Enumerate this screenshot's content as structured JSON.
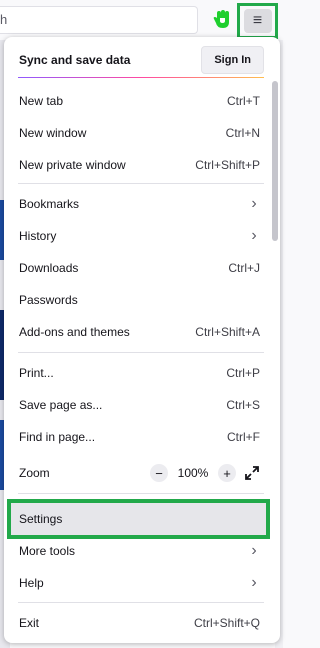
{
  "toolbar": {
    "url_text": "h"
  },
  "menu": {
    "sync": {
      "label": "Sync and save data",
      "signin": "Sign In"
    },
    "new_tab": {
      "label": "New tab",
      "shortcut": "Ctrl+T"
    },
    "new_window": {
      "label": "New window",
      "shortcut": "Ctrl+N"
    },
    "new_private": {
      "label": "New private window",
      "shortcut": "Ctrl+Shift+P"
    },
    "bookmarks": {
      "label": "Bookmarks"
    },
    "history": {
      "label": "History"
    },
    "downloads": {
      "label": "Downloads",
      "shortcut": "Ctrl+J"
    },
    "passwords": {
      "label": "Passwords"
    },
    "addons": {
      "label": "Add-ons and themes",
      "shortcut": "Ctrl+Shift+A"
    },
    "print": {
      "label": "Print...",
      "shortcut": "Ctrl+P"
    },
    "save_page": {
      "label": "Save page as...",
      "shortcut": "Ctrl+S"
    },
    "find": {
      "label": "Find in page...",
      "shortcut": "Ctrl+F"
    },
    "zoom": {
      "label": "Zoom",
      "minus": "−",
      "value": "100%",
      "plus": "+"
    },
    "settings": {
      "label": "Settings"
    },
    "more_tools": {
      "label": "More tools"
    },
    "help": {
      "label": "Help"
    },
    "exit": {
      "label": "Exit",
      "shortcut": "Ctrl+Shift+Q"
    }
  },
  "icons": {
    "hamburger": "≡",
    "chevron": "›"
  },
  "colors": {
    "highlight_border": "#22a94a",
    "extension_icon": "#1fcf2e"
  }
}
